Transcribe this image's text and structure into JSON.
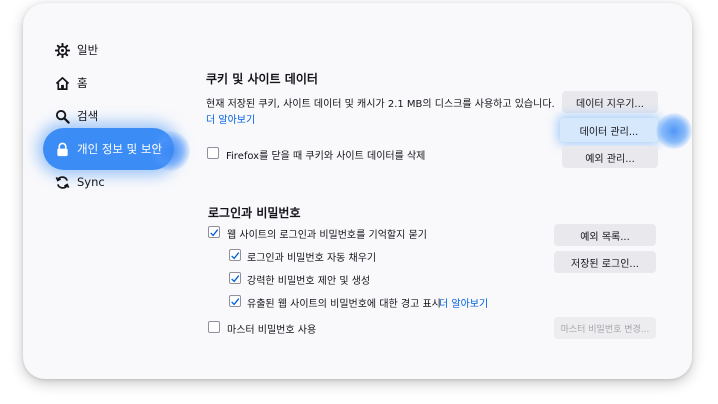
{
  "sidebar": {
    "items": [
      {
        "label": "일반",
        "icon": "gear-icon"
      },
      {
        "label": "홈",
        "icon": "home-icon"
      },
      {
        "label": "검색",
        "icon": "search-icon"
      },
      {
        "label": "개인 정보 및 보안",
        "icon": "lock-icon",
        "active": true
      },
      {
        "label": "Sync",
        "icon": "sync-icon"
      }
    ]
  },
  "cookies": {
    "heading": "쿠키 및 사이트 데이터",
    "description": "현재 저장된 쿠키, 사이트 데이터 및 캐시가 2.1 MB의 디스크를 사용하고 있습니다.",
    "learn_more": "더 알아보기",
    "delete_on_close_label": "Firefox를 닫을 때 쿠키와 사이트 데이터를 삭제",
    "delete_on_close_checked": false,
    "clear_data_button": "데이터 지우기...",
    "manage_data_button": "데이터 관리...",
    "manage_exceptions_button": "예외 관리..."
  },
  "logins": {
    "heading": "로그인과 비밀번호",
    "ask_to_save_label": "웹 사이트의 로그인과 비밀번호를 기억할지 묻기",
    "ask_to_save_checked": true,
    "autofill_label": "로그인과 비밀번호 자동 채우기",
    "autofill_checked": true,
    "suggest_label": "강력한 비밀번호 제안 및 생성",
    "suggest_checked": true,
    "breach_label": "유출된 웹 사이트의 비밀번호에 대한 경고 표시",
    "breach_checked": true,
    "breach_learn_more": "더 알아보기",
    "master_password_label": "마스터 비밀번호 사용",
    "master_password_checked": false,
    "exceptions_button": "예외 목록...",
    "saved_logins_button": "저장된 로그인...",
    "change_master_password_button": "마스터 비밀번호 변경..."
  },
  "colors": {
    "accent": "#0061e0",
    "highlight": "#3b8cf5",
    "check": "#0061e0"
  }
}
